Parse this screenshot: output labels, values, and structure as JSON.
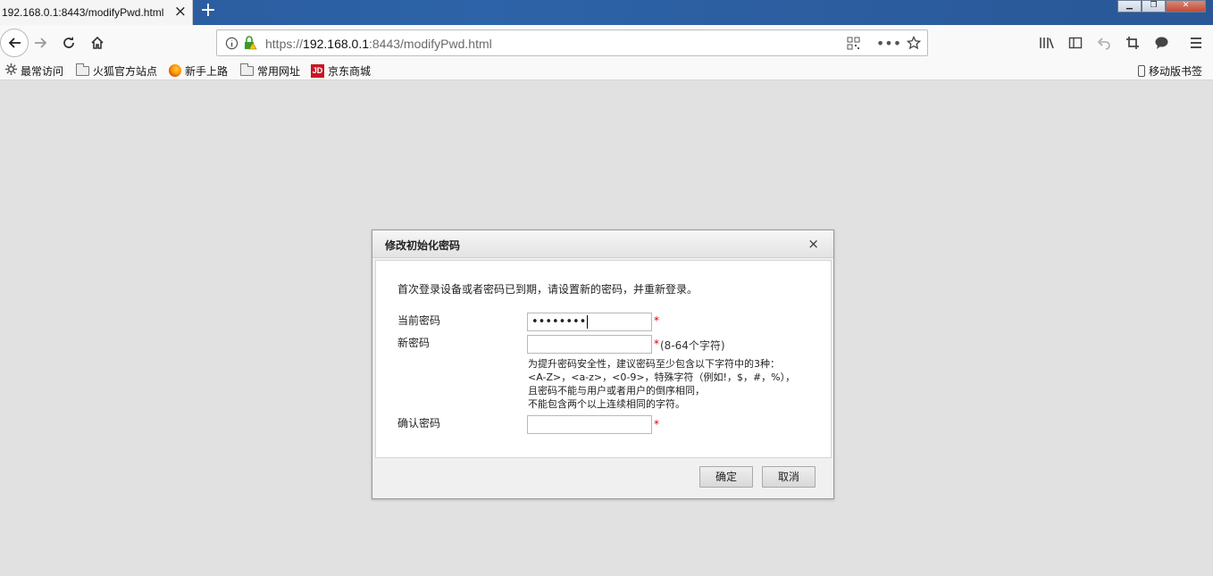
{
  "browser": {
    "tab_title": "192.168.0.1:8443/modifyPwd.html",
    "tab_close": "×",
    "new_tab": "+",
    "url_scheme": "https://",
    "url_host": "192.168.0.1",
    "url_rest": ":8443/modifyPwd.html",
    "window_buttons": {
      "minimize": "▁",
      "restore": "❐",
      "close": "✕"
    }
  },
  "bookmarks": [
    {
      "label": "最常访问",
      "icon": "gear-icon"
    },
    {
      "label": "火狐官方站点",
      "icon": "folder-icon"
    },
    {
      "label": "新手上路",
      "icon": "firefox-icon"
    },
    {
      "label": "常用网址",
      "icon": "folder-icon"
    },
    {
      "label": "京东商城",
      "icon": "jd-icon"
    }
  ],
  "jd_logo_text": "JD",
  "mobile_bookmarks": "移动版书签",
  "dialog": {
    "title": "修改初始化密码",
    "close": "×",
    "intro": "首次登录设备或者密码已到期，请设置新的密码，并重新登录。",
    "current_password_label": "当前密码",
    "current_password_value": "••••••••",
    "new_password_label": "新密码",
    "new_password_value": "",
    "confirm_password_label": "确认密码",
    "confirm_password_value": "",
    "required_mark": "*",
    "length_hint": "(8-64个字符)",
    "tips": [
      "为提升密码安全性，建议密码至少包含以下字符中的3种：",
      "<A-Z>，<a-z>，<0-9>，特殊字符（例如!，$，#，%），",
      "且密码不能与用户或者用户的倒序相同，",
      "不能包含两个以上连续相同的字符。"
    ],
    "ok_button": "确定",
    "cancel_button": "取消"
  }
}
